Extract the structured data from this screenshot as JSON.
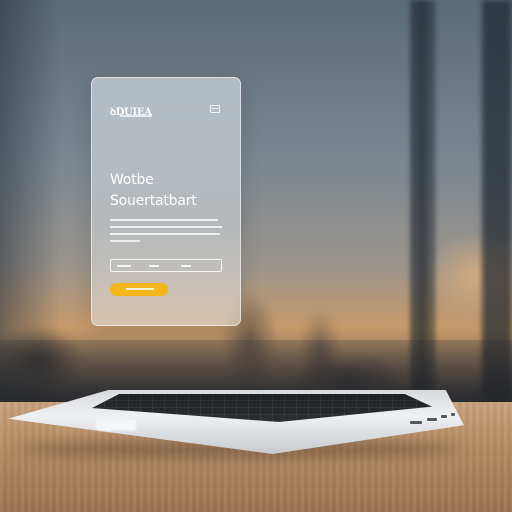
{
  "card": {
    "logo_text": "ꝺDUIEA",
    "headline_line1": "Wotbe",
    "headline_line2": "Souertatbart",
    "cta_color": "#f4b61a",
    "icons": [
      "menu-icon"
    ]
  }
}
